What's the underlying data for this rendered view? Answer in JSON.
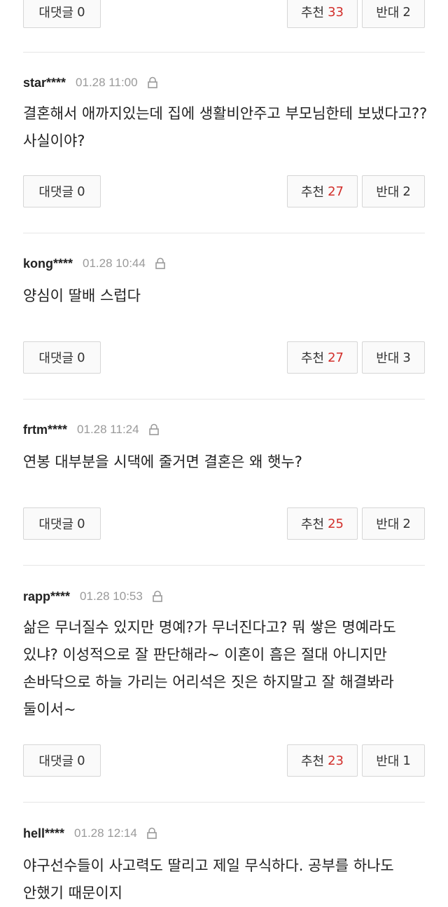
{
  "labels": {
    "reply": "대댓글",
    "upvote": "추천",
    "downvote": "반대"
  },
  "colors": {
    "upvote_count": "#d2302c",
    "divider": "#e6e6e6",
    "time": "#9a9a9a"
  },
  "top_actions": {
    "reply_count": "0",
    "upvotes": "33",
    "downvotes": "2"
  },
  "comments": [
    {
      "user": "star****",
      "time": "01.28 11:00",
      "icon": "lock-icon",
      "text": "결혼해서 애까지있는데 집에 생활비안주고 부모님한테 보냈다고?? 사실이야?",
      "reply_count": "0",
      "upvotes": "27",
      "downvotes": "2"
    },
    {
      "user": "kong****",
      "time": "01.28 10:44",
      "icon": "lock-icon",
      "text": "양심이 딸배 스럽다",
      "reply_count": "0",
      "upvotes": "27",
      "downvotes": "3"
    },
    {
      "user": "frtm****",
      "time": "01.28 11:24",
      "icon": "lock-icon",
      "text": "연봉 대부분을 시댁에 줄거면 결혼은 왜 햇누?",
      "reply_count": "0",
      "upvotes": "25",
      "downvotes": "2"
    },
    {
      "user": "rapp****",
      "time": "01.28 10:53",
      "icon": "lock-icon",
      "text": "삶은 무너질수 있지만 명예?가 무너진다고? 뭐 쌓은 명예라도 있냐? 이성적으로 잘 판단해라~ 이혼이 흠은 절대 아니지만 손바닥으로 하늘 가리는 어리석은 짓은 하지말고 잘 해결봐라 둘이서~",
      "reply_count": "0",
      "upvotes": "23",
      "downvotes": "1"
    },
    {
      "user": "hell****",
      "time": "01.28 12:14",
      "icon": "lock-icon",
      "text": "야구선수들이 사고력도 딸리고 제일 무식하다. 공부를 하나도 안했기 때문이지"
    }
  ]
}
